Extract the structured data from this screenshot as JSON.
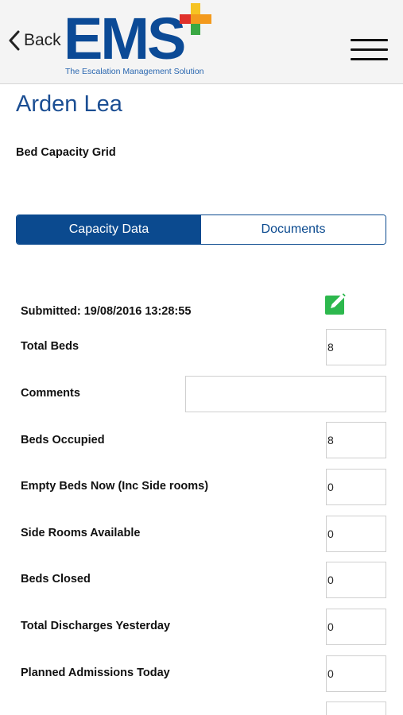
{
  "header": {
    "back_label": "Back",
    "logo_text": "EMS",
    "logo_tagline": "The Escalation Management Solution",
    "logo_plus_colors": [
      "#e0312b",
      "#f39a1d",
      "#3aa844",
      "#f6c323"
    ],
    "menu_icon": "hamburger-menu-icon"
  },
  "page": {
    "title": "Arden Lea",
    "subtitle": "Bed Capacity Grid"
  },
  "tabs": [
    {
      "label": "Capacity Data",
      "active": true
    },
    {
      "label": "Documents",
      "active": false
    }
  ],
  "form": {
    "submitted": "Submitted: 19/08/2016 13:28:55",
    "edit_icon": "edit-icon",
    "edit_icon_color": "#2db84d",
    "fields": [
      {
        "label": "Total Beds",
        "value": "8"
      },
      {
        "label": "Comments",
        "value": ""
      },
      {
        "label": "Beds Occupied",
        "value": "8"
      },
      {
        "label": "Empty Beds Now (Inc Side rooms)",
        "value": "0"
      },
      {
        "label": "Side Rooms Available",
        "value": "0"
      },
      {
        "label": "Beds Closed",
        "value": "0"
      },
      {
        "label": "Total Discharges Yesterday",
        "value": "0"
      },
      {
        "label": "Planned Admissions Today",
        "value": "0"
      }
    ]
  },
  "colors": {
    "primary": "#0b4a8f",
    "title": "#1b4e93",
    "header_bg": "#f4f4f4"
  }
}
